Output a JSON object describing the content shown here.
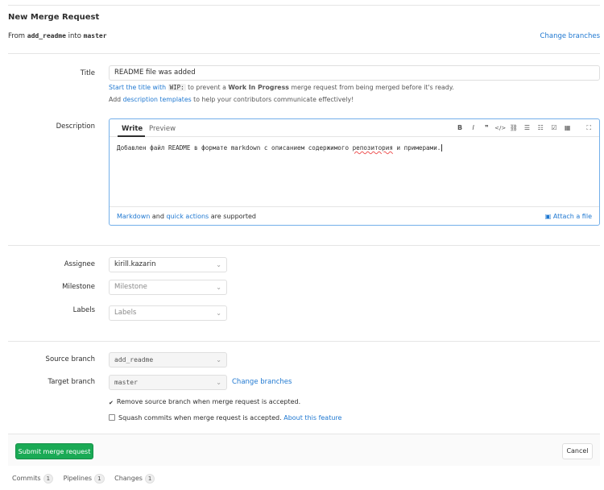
{
  "header": {
    "title": "New Merge Request",
    "from_prefix": "From",
    "source": "add_readme",
    "into": "into",
    "target": "master",
    "change_branches": "Change branches"
  },
  "title_field": {
    "label": "Title",
    "value": "README file was added",
    "hint_start": "Start the title with",
    "hint_code": "WIP:",
    "hint_middle": "to prevent a",
    "hint_bold": "Work In Progress",
    "hint_end": "merge request from being merged before it's ready.",
    "hint2_start": "Add",
    "hint2_link": "description templates",
    "hint2_end": "to help your contributors communicate effectively!"
  },
  "description": {
    "label": "Description",
    "tab_write": "Write",
    "tab_preview": "Preview",
    "text_before": "Добавлен файл README в формате markdown с описанием содержимого ",
    "text_underlined": "репозитория",
    "text_after": " и примерами.",
    "footer_markdown": "Markdown",
    "footer_and": "and",
    "footer_quick": "quick actions",
    "footer_supported": "are supported",
    "attach": "Attach a file",
    "toolbar_icons": [
      "bold-icon",
      "italic-icon",
      "quote-icon",
      "code-icon",
      "link-icon",
      "bullet-list-icon",
      "numbered-list-icon",
      "task-list-icon",
      "table-icon",
      "fullscreen-icon"
    ]
  },
  "assignee": {
    "label": "Assignee",
    "value": "kirill.kazarin"
  },
  "milestone": {
    "label": "Milestone",
    "placeholder": "Milestone"
  },
  "labels": {
    "label": "Labels",
    "placeholder": "Labels"
  },
  "source_branch": {
    "label": "Source branch",
    "value": "add_readme"
  },
  "target_branch": {
    "label": "Target branch",
    "value": "master",
    "change": "Change branches"
  },
  "options": {
    "remove_source": "Remove source branch when merge request is accepted.",
    "remove_checked": true,
    "squash": "Squash commits when merge request is accepted.",
    "squash_checked": false,
    "about": "About this feature"
  },
  "actions": {
    "submit": "Submit merge request",
    "cancel": "Cancel"
  },
  "bottom_tabs": [
    {
      "label": "Commits",
      "count": "1"
    },
    {
      "label": "Pipelines",
      "count": "1"
    },
    {
      "label": "Changes",
      "count": "1"
    }
  ],
  "colors": {
    "link": "#1f78d1",
    "submit_bg": "#1aaa55",
    "focus_border": "#73afea"
  }
}
